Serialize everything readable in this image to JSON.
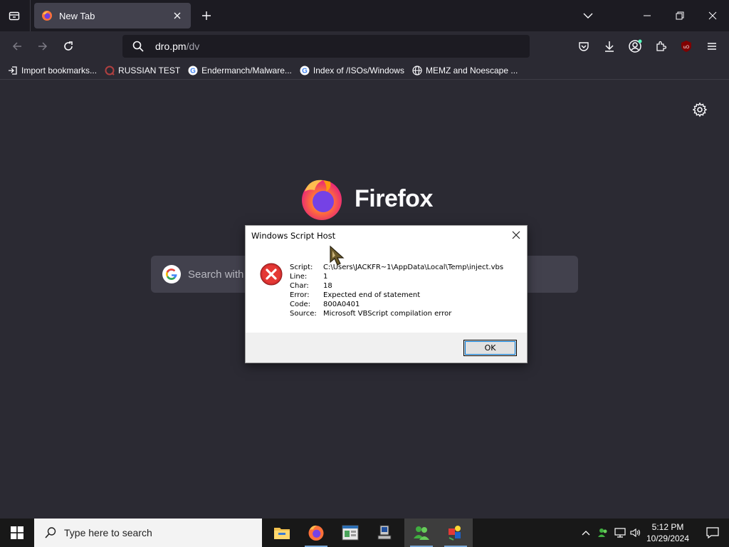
{
  "browser": {
    "tab_title": "New Tab",
    "url_host": "dro.pm",
    "url_path": "/dv",
    "icons": [
      "tab-list-icon",
      "firefox-favicon",
      "close-icon",
      "plus-icon",
      "chevron-down-icon",
      "minimize-icon",
      "restore-icon",
      "close-window-icon",
      "back-icon",
      "forward-icon",
      "reload-icon",
      "search-icon",
      "pocket-icon",
      "download-icon",
      "account-icon",
      "extensions-icon",
      "ublock-icon",
      "menu-icon"
    ]
  },
  "bookmarks": [
    {
      "label": "Import bookmarks...",
      "icon": "import-icon"
    },
    {
      "label": "RUSSIAN TEST",
      "icon": "globe-icon"
    },
    {
      "label": "Endermanch/Malware...",
      "icon": "google-icon"
    },
    {
      "label": "Index of /ISOs/Windows",
      "icon": "google-icon"
    },
    {
      "label": "MEMZ and Noescape ...",
      "icon": "globe-icon"
    }
  ],
  "newtab": {
    "brand": "Firefox",
    "search_placeholder": "Search with",
    "settings_icon": "gear-icon"
  },
  "dialog": {
    "title": "Windows Script Host",
    "rows": [
      {
        "k": "Script:",
        "v": "C:\\Users\\JACKFR~1\\AppData\\Local\\Temp\\inject.vbs"
      },
      {
        "k": "Line:",
        "v": "1"
      },
      {
        "k": "Char:",
        "v": "18"
      },
      {
        "k": "Error:",
        "v": "Expected end of statement"
      },
      {
        "k": "Code:",
        "v": "800A0401"
      },
      {
        "k": "Source:",
        "v": "Microsoft VBScript compilation error"
      }
    ],
    "ok_label": "OK",
    "error_icon": "error-icon"
  },
  "taskbar": {
    "search_placeholder": "Type here to search",
    "time": "5:12 PM",
    "date": "10/29/2024",
    "apps": [
      "file-explorer-icon",
      "firefox-icon",
      "app-window-icon",
      "computer-icon",
      "network-people-icon",
      "paint-icon"
    ]
  },
  "colors": {
    "chrome": "#1c1b22",
    "content_bg": "#2b2a33",
    "tab_active": "#42414d",
    "dialog_bg": "#f0f0f0",
    "taskbar_bg": "#181818"
  }
}
